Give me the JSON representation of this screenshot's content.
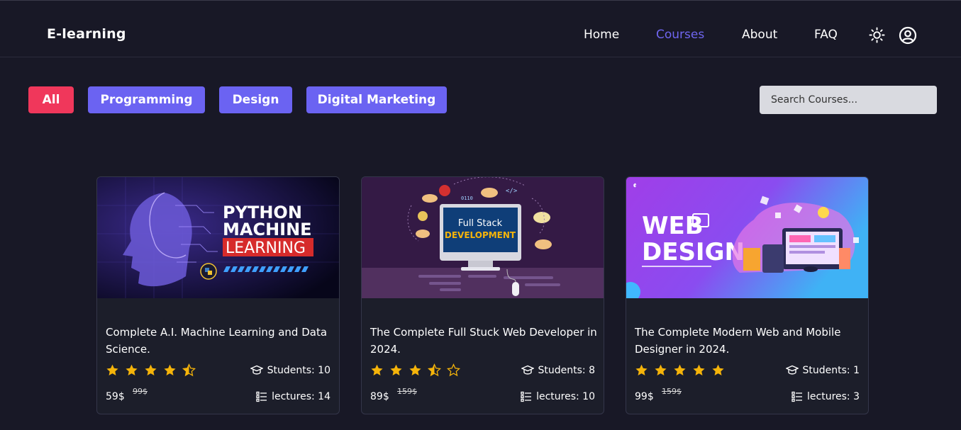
{
  "header": {
    "logo": "E-learning",
    "nav": [
      {
        "label": "Home",
        "active": false
      },
      {
        "label": "Courses",
        "active": true
      },
      {
        "label": "About",
        "active": false
      },
      {
        "label": "FAQ",
        "active": false
      }
    ],
    "icons": [
      "sun-icon",
      "user-circle-icon"
    ]
  },
  "filters": {
    "buttons": [
      {
        "label": "All",
        "color": "#f0375b"
      },
      {
        "label": "Programming",
        "color": "#6b63f2"
      },
      {
        "label": "Design",
        "color": "#6b63f2"
      },
      {
        "label": "Digital Marketing",
        "color": "#6b63f2"
      }
    ],
    "search_placeholder": "Search Courses..."
  },
  "courses": [
    {
      "title": "Complete A.I. Machine Learning and Data Science.",
      "image_text": [
        "PYTHON",
        "MACHINE",
        "LEARNING"
      ],
      "rating": 4.5,
      "students": "Students: 10",
      "price": "59$",
      "old_price": "99$",
      "lectures": "lectures: 14"
    },
    {
      "title": "The Complete Full Stuck Web Developer in 2024.",
      "image_text": [
        "Full Stack",
        "DEVELOPMENT"
      ],
      "rating": 3.5,
      "students": "Students: 8",
      "price": "89$",
      "old_price": "159$",
      "lectures": "lectures: 10"
    },
    {
      "title": "The Complete Modern Web and Mobile Designer in 2024.",
      "image_text": [
        "WEB",
        "DESIGN"
      ],
      "rating": 5,
      "students": "Students: 1",
      "price": "99$",
      "old_price": "159$",
      "lectures": "lectures: 3"
    }
  ],
  "colors": {
    "background": "#181826",
    "card": "#1c1e2a",
    "accent": "#6b63f2",
    "active_nav": "#6f66f0",
    "star": "#f5b40a"
  }
}
